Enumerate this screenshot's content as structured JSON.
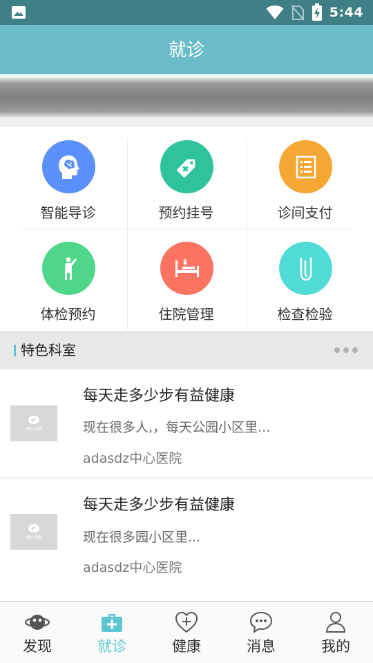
{
  "status_bar": {
    "time": "5:44",
    "icons": [
      "image-icon",
      "wifi-icon",
      "no-sim-icon",
      "battery-charging-icon"
    ]
  },
  "header": {
    "title": "就诊"
  },
  "banner": {
    "description": ""
  },
  "services": [
    {
      "label": "智能导诊",
      "icon": "brain-head-icon",
      "color": "#5b8ff9"
    },
    {
      "label": "预约挂号",
      "icon": "tag-plus-icon",
      "color": "#2ec39b"
    },
    {
      "label": "诊间支付",
      "icon": "receipt-icon",
      "color": "#f5a734"
    },
    {
      "label": "体检预约",
      "icon": "person-icon",
      "color": "#4fd68a"
    },
    {
      "label": "住院管理",
      "icon": "hospital-bed-icon",
      "color": "#fb7462"
    },
    {
      "label": "检查检验",
      "icon": "test-tube-icon",
      "color": "#51dbd6"
    }
  ],
  "section": {
    "title": "特色科室"
  },
  "articles": [
    {
      "title": "每天走多少步有益健康",
      "summary": "现在很多人,，每天公园小区里...",
      "source": "adasdz中心医院",
      "thumb_text": "图片加载"
    },
    {
      "title": "每天走多少步有益健康",
      "summary": "现在很多园小区里...",
      "source": "adasdz中心医院",
      "thumb_text": "图片加载"
    }
  ],
  "bottom_nav": {
    "items": [
      {
        "label": "发现",
        "icon": "planet-icon",
        "active": false
      },
      {
        "label": "就诊",
        "icon": "medical-kit-icon",
        "active": true
      },
      {
        "label": "健康",
        "icon": "heart-plus-icon",
        "active": false
      },
      {
        "label": "消息",
        "icon": "chat-bubble-icon",
        "active": false
      },
      {
        "label": "我的",
        "icon": "user-icon",
        "active": false
      }
    ]
  },
  "colors": {
    "status_bar": "#3f7f86",
    "header": "#6bbcc8",
    "accent": "#5ec6d2"
  }
}
